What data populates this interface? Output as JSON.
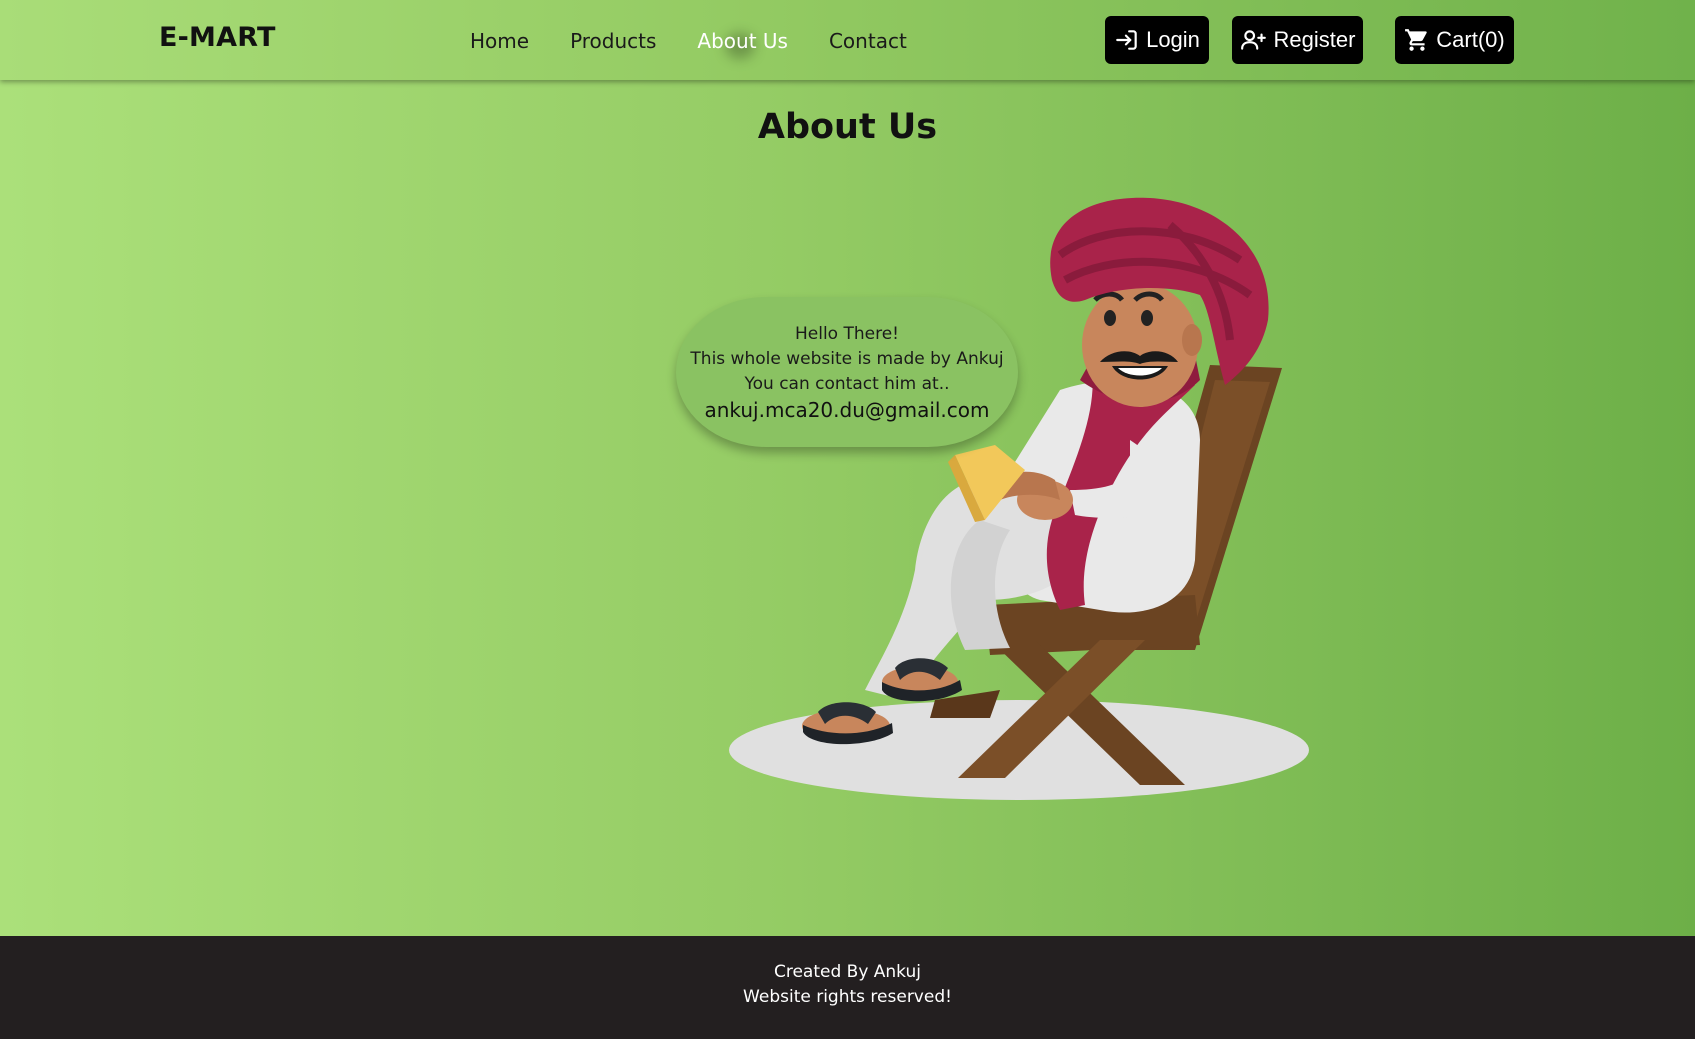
{
  "navbar": {
    "brand": "E-MART",
    "links": [
      {
        "label": "Home"
      },
      {
        "label": "Products"
      },
      {
        "label": "About Us",
        "active": true
      },
      {
        "label": "Contact"
      }
    ],
    "login_label": "Login",
    "register_label": "Register",
    "cart_label": "Cart(0)",
    "icons": {
      "login": "login-icon",
      "register": "user-plus-icon",
      "cart": "cart-icon"
    }
  },
  "main": {
    "title": "About Us",
    "bubble": {
      "line1": "Hello There!",
      "line2": "This whole website is made by Ankuj",
      "line3": "You can contact him at..",
      "email": "ankuj.mca20.du@gmail.com"
    }
  },
  "footer": {
    "line1": "Created By Ankuj",
    "line2": "Website rights reserved!"
  },
  "colors": {
    "background_start": "#abe07a",
    "background_end": "#6daf48",
    "button_bg": "#000000",
    "footer_bg": "#231f20"
  }
}
